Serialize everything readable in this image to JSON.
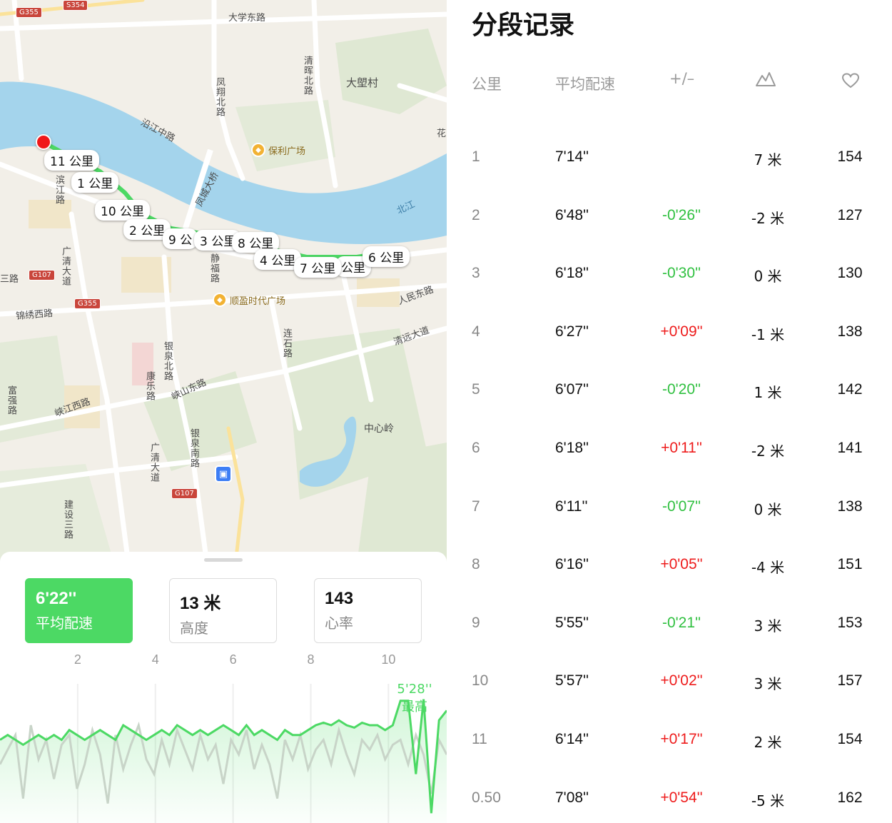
{
  "map": {
    "labels": {
      "road_daxue_east": "大学东路",
      "village_datangcun": "大塱村",
      "road_fengxiang_north": "凤翔北路",
      "road_qinghui_north": "清晖北路",
      "road_yanjiang_middle": "沿江中路",
      "poi_poly_plaza": "保利广场",
      "road_binjiang": "滨江路",
      "bridge_fengcheng": "凤城大桥",
      "river_beijiang": "北江",
      "road_guangqing": "广清大道",
      "road_jingfu": "静福路",
      "road_san": "三路",
      "road_jinxiu_west": "锦绣西路",
      "poi_shunying": "顺盈时代广场",
      "road_renmin_east": "人民东路",
      "road_qingyuan": "清远大道",
      "road_lianshi": "连石路",
      "road_yinquan_north": "银泉北路",
      "road_kangle": "康乐路",
      "road_xiashan": "峡山东路",
      "road_fuqiang": "富强路",
      "road_xiajiang_west": "峡江西路",
      "poi_zhongxinling": "中心岭",
      "road_yinquan_south": "银泉南路",
      "road_guangqing2": "广清大道",
      "road_jianshe3": "建设三路",
      "road_mao": "花"
    },
    "shields": {
      "g355_top": "G355",
      "s354": "S354",
      "g107_left": "G107",
      "g355_mid": "G355",
      "g107_bottom": "G107"
    },
    "km_markers": [
      "11 公里",
      "1 公里",
      "10 公里",
      "2 公里",
      "9 公",
      "3 公里",
      "8 公里",
      "4 公里",
      "7 公里",
      "公里",
      "6 公里"
    ],
    "metro_icon": "metro-icon",
    "route_color": "#4cd964"
  },
  "summary": {
    "pace": {
      "value": "6'22''",
      "label": "平均配速"
    },
    "elevation": {
      "value": "13 米",
      "label": "高度"
    },
    "heart_rate": {
      "value": "143",
      "label": "心率"
    }
  },
  "chart_data": {
    "type": "line",
    "x_ticks": [
      "2",
      "4",
      "6",
      "8",
      "10"
    ],
    "xlim": [
      0,
      11.5
    ],
    "best_label_value": "5'28''",
    "best_label_text": "最高",
    "series": [
      {
        "color": "#4cd964",
        "values": [
          6.3,
          6.2,
          6.3,
          6.4,
          6.3,
          6.2,
          6.3,
          6.2,
          6.3,
          6.1,
          6.2,
          6.3,
          6.2,
          6.1,
          6.2,
          6.3,
          6.0,
          6.1,
          6.2,
          6.3,
          6.2,
          6.1,
          6.2,
          6.0,
          6.1,
          6.2,
          6.1,
          6.2,
          6.1,
          6.0,
          6.1,
          6.2,
          6.0,
          6.2,
          6.1,
          6.2,
          6.3,
          6.1,
          6.2,
          6.2,
          6.1,
          6.0,
          5.95,
          6.0,
          5.9,
          6.0,
          6.05,
          5.95,
          6.0,
          6.0,
          6.1,
          6.0,
          5.5,
          5.5,
          7.0,
          5.47,
          7.8,
          5.9,
          5.7
        ]
      },
      {
        "color": "#c8d4c8",
        "values": [
          6.8,
          6.5,
          6.2,
          7.5,
          6.0,
          6.7,
          6.3,
          7.1,
          6.4,
          6.2,
          7.3,
          6.8,
          6.1,
          6.6,
          7.6,
          6.2,
          6.9,
          6.4,
          6.0,
          6.7,
          7.0,
          6.3,
          6.8,
          6.1,
          6.5,
          6.9,
          6.2,
          6.7,
          6.4,
          7.2,
          6.3,
          6.6,
          6.1,
          6.9,
          6.4,
          6.8,
          7.5,
          6.3,
          6.7,
          6.2,
          6.9,
          6.5,
          6.3,
          6.8,
          6.1,
          6.6,
          7.0,
          6.3,
          6.5,
          6.2,
          6.7,
          6.4,
          6.3,
          6.8,
          6.2,
          6.6,
          7.4,
          6.3,
          6.6
        ]
      }
    ]
  },
  "splits": {
    "title": "分段记录",
    "headers": {
      "km": "公里",
      "pace": "平均配速",
      "diff": "+/–"
    },
    "header_icons": [
      "elevation-icon",
      "heart-icon"
    ],
    "rows": [
      {
        "km": "1",
        "pace": "7'14''",
        "diff": "",
        "elev": "7 米",
        "hr": "154"
      },
      {
        "km": "2",
        "pace": "6'48''",
        "diff": "-0'26''",
        "elev": "-2 米",
        "hr": "127"
      },
      {
        "km": "3",
        "pace": "6'18''",
        "diff": "-0'30''",
        "elev": "0 米",
        "hr": "130"
      },
      {
        "km": "4",
        "pace": "6'27''",
        "diff": "+0'09''",
        "elev": "-1 米",
        "hr": "138"
      },
      {
        "km": "5",
        "pace": "6'07''",
        "diff": "-0'20''",
        "elev": "1 米",
        "hr": "142"
      },
      {
        "km": "6",
        "pace": "6'18''",
        "diff": "+0'11''",
        "elev": "-2 米",
        "hr": "141"
      },
      {
        "km": "7",
        "pace": "6'11''",
        "diff": "-0'07''",
        "elev": "0 米",
        "hr": "138"
      },
      {
        "km": "8",
        "pace": "6'16''",
        "diff": "+0'05''",
        "elev": "-4 米",
        "hr": "151"
      },
      {
        "km": "9",
        "pace": "5'55''",
        "diff": "-0'21''",
        "elev": "3 米",
        "hr": "153"
      },
      {
        "km": "10",
        "pace": "5'57''",
        "diff": "+0'02''",
        "elev": "3 米",
        "hr": "157"
      },
      {
        "km": "11",
        "pace": "6'14''",
        "diff": "+0'17''",
        "elev": "2 米",
        "hr": "154"
      },
      {
        "km": "0.50",
        "pace": "7'08''",
        "diff": "+0'54''",
        "elev": "-5 米",
        "hr": "162"
      }
    ],
    "colors": {
      "faster": "#30c040",
      "slower": "#ee1c1c"
    }
  }
}
